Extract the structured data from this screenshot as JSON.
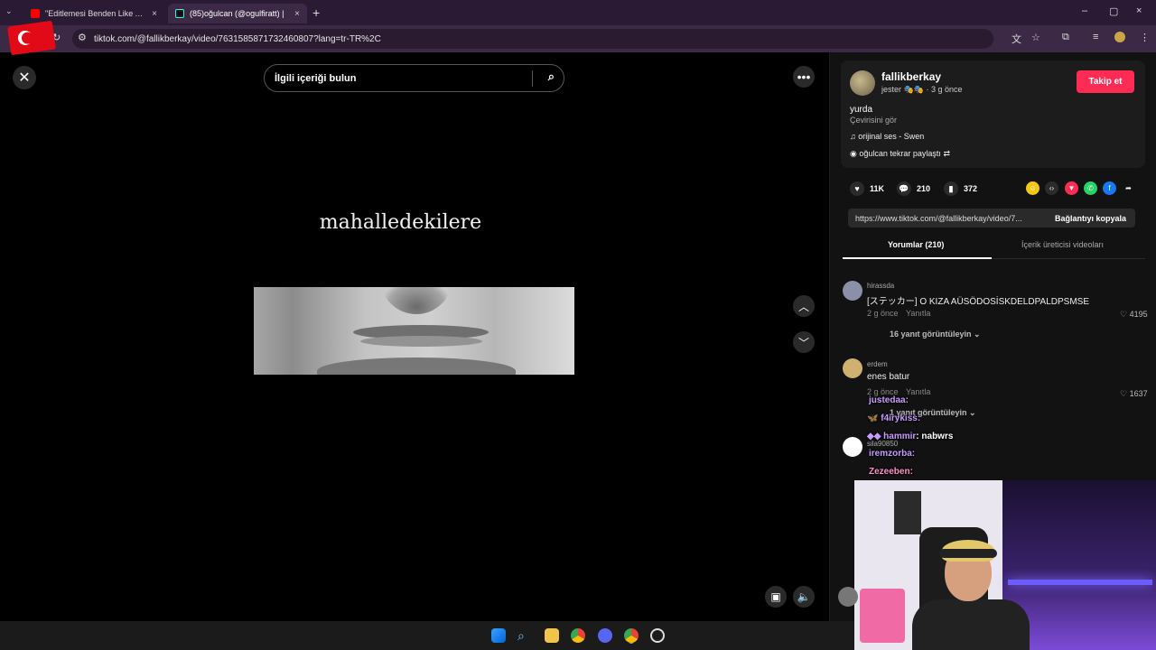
{
  "browser": {
    "tabs": [
      {
        "title": "\"Editlemesi Benden Like Atması",
        "close": "×"
      },
      {
        "title": "(85)oğulcan (@ogulfiratt) |",
        "close": "×"
      }
    ],
    "new_tab": "+",
    "url": "tiktok.com/@fallikberkay/video/7631585871732460807?lang=tr-TR%2C",
    "window_controls": [
      "–",
      "▢",
      "×"
    ]
  },
  "video": {
    "search_placeholder": "İlgili içeriği bulun",
    "overlay_text": "mahalledekilere"
  },
  "post": {
    "username": "fallikberkay",
    "meta_name": "jester",
    "meta_time": "· 3 g önce",
    "follow": "Takip et",
    "description": "yurda",
    "translate": "Çevirisini gör",
    "music": "orijinal ses - Swen",
    "repost": "oğulcan tekrar paylaştı",
    "likes": "11K",
    "comments": "210",
    "saves": "372",
    "share_icons": [
      "coin-icon",
      "embed-icon",
      "send-icon",
      "whatsapp-icon",
      "facebook-icon",
      "forward-icon"
    ],
    "link": "https://www.tiktok.com/@fallikberkay/video/7...",
    "copy_link": "Bağlantıyı kopyala"
  },
  "comment_tabs": {
    "comments": "Yorumlar (210)",
    "creator_videos": "İçerik üreticisi videoları"
  },
  "comments": [
    {
      "name": "hirassda",
      "text": "[ステッカー] O KIZA AÜSÖDOSİSKDELDPALDPSMSE",
      "time": "2 g önce",
      "reply": "Yanıtla",
      "likes": "4195",
      "view_replies": "16 yanıt görüntüleyin"
    },
    {
      "name": "erdem",
      "text": "enes batur",
      "time": "2 g önce",
      "reply": "Yanıtla",
      "likes": "1637",
      "view_replies": "1 yanıt görüntüleyin"
    },
    {
      "name": "sila90850"
    }
  ],
  "stream_chat": [
    {
      "name": "justedaa",
      "text": ":"
    },
    {
      "name": "f4irykiss",
      "text": ":"
    },
    {
      "name": "hammir",
      "text": ": nabwrs"
    },
    {
      "name": "iremzorba",
      "text": ":"
    },
    {
      "name": "Zezeeben",
      "text": ":"
    }
  ],
  "colors": {
    "accent": "#fe2c55",
    "panel": "#121212",
    "chat_name": "#b57bff"
  }
}
